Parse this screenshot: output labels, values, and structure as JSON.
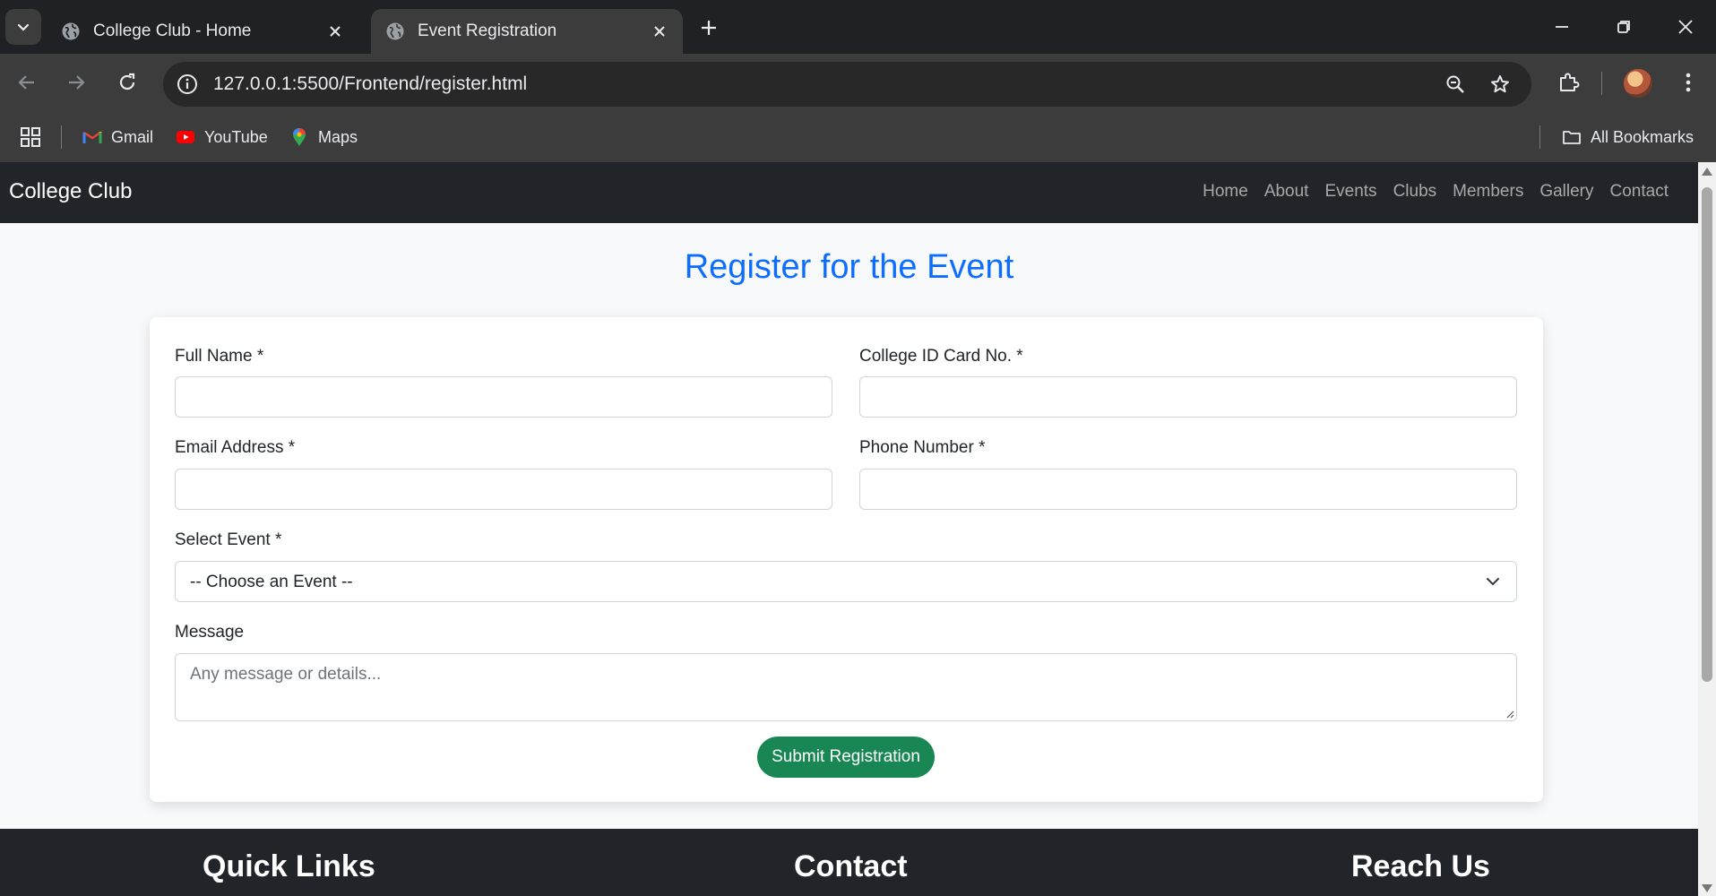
{
  "browser": {
    "tabs": [
      {
        "title": "College Club - Home"
      },
      {
        "title": "Event Registration"
      }
    ],
    "url": "127.0.0.1:5500/Frontend/register.html",
    "bookmarks": [
      {
        "label": "Gmail"
      },
      {
        "label": "YouTube"
      },
      {
        "label": "Maps"
      }
    ],
    "all_bookmarks_label": "All Bookmarks"
  },
  "navbar": {
    "brand": "College Club",
    "links": [
      "Home",
      "About",
      "Events",
      "Clubs",
      "Members",
      "Gallery",
      "Contact"
    ]
  },
  "main": {
    "heading": "Register for the Event",
    "form": {
      "full_name_label": "Full Name *",
      "full_name_value": "",
      "college_id_label": "College ID Card No. *",
      "college_id_value": "",
      "email_label": "Email Address *",
      "email_value": "",
      "phone_label": "Phone Number *",
      "phone_value": "",
      "event_label": "Select Event *",
      "event_selected": "-- Choose an Event --",
      "message_label": "Message",
      "message_placeholder": "Any message or details...",
      "submit_label": "Submit Registration"
    }
  },
  "footer": {
    "headings": [
      "Quick Links",
      "Contact",
      "Reach Us"
    ]
  },
  "colors": {
    "primary": "#0d6efd",
    "success": "#198754",
    "dark": "#212529"
  }
}
